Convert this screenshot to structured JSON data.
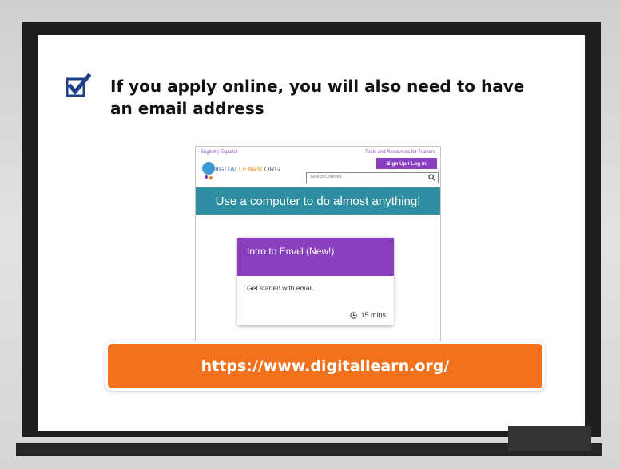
{
  "slide": {
    "headline_line1": "If you apply online, you will also need to have",
    "headline_line2": "an email address",
    "checkbox_icon": "checked-box-icon"
  },
  "website": {
    "language_links": "English | Español",
    "tools_link": "Tools and Resources for Trainers",
    "signup_label": "Sign Up / Log In",
    "logo": {
      "part1": "DIGITAL",
      "part2": "LEARN",
      "part3": ".ORG"
    },
    "search_placeholder": "Search Courses",
    "banner_text": "Use a computer to do almost anything!",
    "course": {
      "title": "Intro to Email (New!)",
      "description": "Get started with email.",
      "duration": "15 mins"
    }
  },
  "url": "https://www.digitallearn.org/",
  "colors": {
    "purple": "#8a3fbf",
    "teal": "#2e8fa3",
    "orange": "#f2711c",
    "checkbox": "#1f3f86"
  }
}
